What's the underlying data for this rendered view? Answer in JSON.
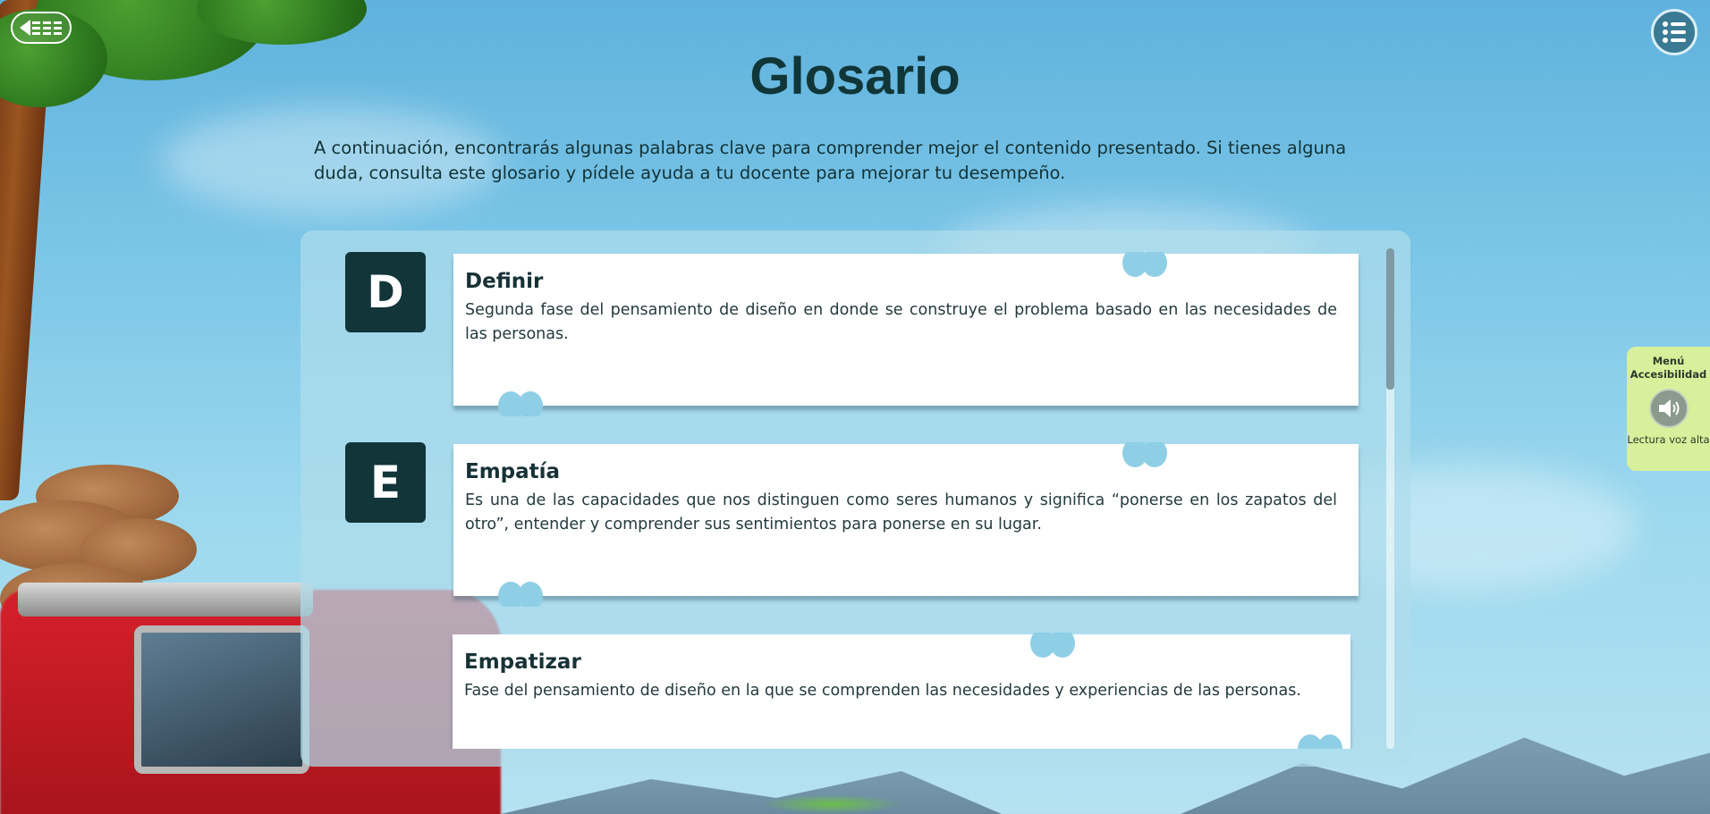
{
  "colors": {
    "title": "#113638",
    "letter_box": "#123539",
    "accessibility_panel": "#d8f09b",
    "menu_button": "#3a7a94"
  },
  "nav": {
    "back_icon": "arrow-left-dashed-icon",
    "menu_icon": "list-menu-icon"
  },
  "page": {
    "title": "Glosario",
    "intro": "A continuación, encontrarás algunas palabras clave para comprender mejor el contenido presentado. Si tienes alguna duda, consulta este glosario y pídele ayuda a tu docente para mejorar tu desempeño."
  },
  "glossary": {
    "letters": [
      "D",
      "E"
    ],
    "entries": [
      {
        "term": "Definir",
        "definition": "Segunda fase del pensamiento de diseño en donde se construye el problema basado en las necesidades de las personas."
      },
      {
        "term": "Empatía",
        "definition": "Es una de las capacidades que nos distinguen como seres humanos y significa “ponerse en los zapatos del otro”, entender y comprender sus sentimientos para ponerse en su lugar."
      },
      {
        "term": "Empatizar",
        "definition": "Fase del pensamiento de diseño en la que se comprenden las necesidades y experiencias de las personas."
      }
    ]
  },
  "accessibility": {
    "title": "Menú Accesibilidad",
    "read_aloud_label": "Lectura voz alta",
    "speaker_icon": "speaker-icon"
  }
}
